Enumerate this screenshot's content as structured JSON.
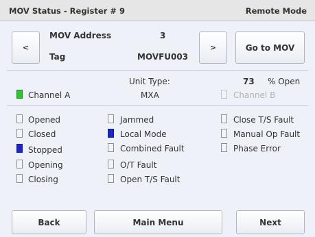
{
  "title_bar": {
    "title": "MOV Status - Register # 9",
    "mode": "Remote Mode"
  },
  "nav": {
    "prev_label": "<",
    "next_label": ">",
    "goto_label": "Go to MOV"
  },
  "mov_info": {
    "address_label": "MOV Address",
    "address_value": "3",
    "tag_label": "Tag",
    "tag_value": "MOVFU003"
  },
  "unit_info": {
    "unit_type_label": "Unit Type:",
    "unit_type_value": "MXA",
    "open_value": "73",
    "open_label": "% Open",
    "channel_a_label": "Channel A",
    "channel_b_label": "Channel B"
  },
  "status_colors": {
    "active_blue": "#1b26c8",
    "active_green": "#2ec52e",
    "inactive": "#f3f4f6"
  },
  "status": {
    "col1": [
      {
        "label": "Opened",
        "active": false
      },
      {
        "label": "Closed",
        "active": false
      },
      {
        "label": "Stopped",
        "active": true
      },
      {
        "label": "Opening",
        "active": false
      },
      {
        "label": "Closing",
        "active": false
      }
    ],
    "col2": [
      {
        "label": "Jammed",
        "active": false
      },
      {
        "label": "Local Mode",
        "active": true
      },
      {
        "label": "Combined Fault",
        "active": false
      },
      {
        "label": "O/T Fault",
        "active": false
      },
      {
        "label": "Open T/S Fault",
        "active": false
      }
    ],
    "col3": [
      {
        "label": "Close T/S Fault",
        "active": false
      },
      {
        "label": "Manual Op Fault",
        "active": false
      },
      {
        "label": "Phase Error",
        "active": false
      }
    ]
  },
  "footer": {
    "back_label": "Back",
    "main_menu_label": "Main Menu",
    "next_label": "Next"
  }
}
